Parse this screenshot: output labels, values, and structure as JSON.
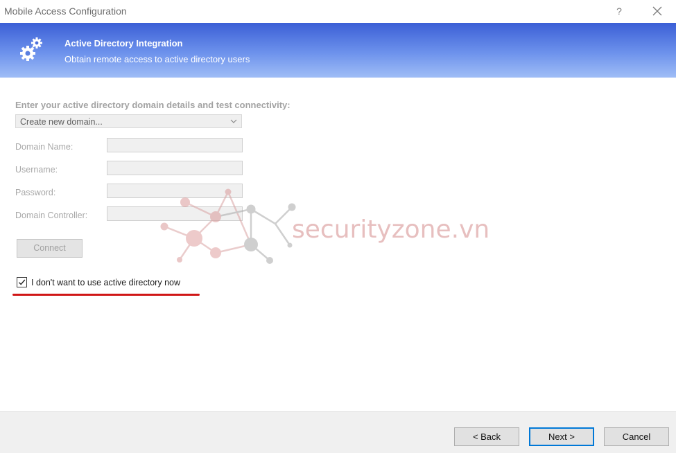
{
  "window": {
    "title": "Mobile Access Configuration",
    "help_label": "?",
    "close_icon": "close-icon"
  },
  "banner": {
    "title": "Active Directory Integration",
    "subtitle": "Obtain remote access to active directory users",
    "icon": "gears-icon"
  },
  "form": {
    "instruction": "Enter your active directory domain details and test connectivity:",
    "domain_select": {
      "value": "Create new domain..."
    },
    "fields": [
      {
        "label": "Domain Name:",
        "value": ""
      },
      {
        "label": "Username:",
        "value": ""
      },
      {
        "label": "Password:",
        "value": ""
      },
      {
        "label": "Domain Controller:",
        "value": ""
      }
    ],
    "connect_label": "Connect",
    "skip_checkbox": {
      "label": "I don't want to use active directory now",
      "checked": true
    }
  },
  "watermark": {
    "text": "securityzone.vn"
  },
  "footer": {
    "back_label": "< Back",
    "next_label": "Next >",
    "cancel_label": "Cancel"
  },
  "colors": {
    "banner_top": "#3b5fd6",
    "banner_bottom": "#9fbdf6",
    "annotation_underline": "#d01616",
    "default_button_border": "#0078d7"
  }
}
